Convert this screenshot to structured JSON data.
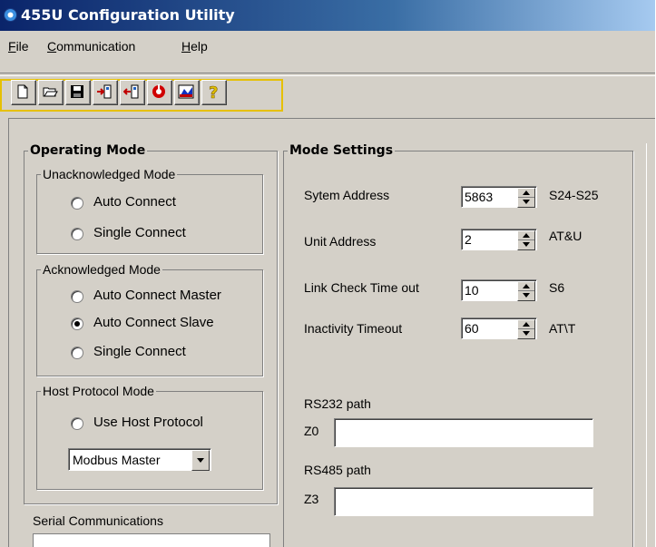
{
  "window": {
    "title": "455U Configuration Utility"
  },
  "menu": [
    {
      "label_pre": "",
      "accel": "F",
      "label_post": "ile"
    },
    {
      "label_pre": "",
      "accel": "C",
      "label_post": "ommunication"
    },
    {
      "label_pre": "",
      "accel": "H",
      "label_post": "elp"
    }
  ],
  "toolbar": {
    "buttons": [
      "new-file-icon",
      "open-folder-icon",
      "save-disk-icon",
      "read-config-icon",
      "write-config-icon",
      "reset-icon",
      "graph-icon",
      "help-icon"
    ]
  },
  "operating_mode": {
    "title": "Operating Mode",
    "unack": {
      "title": "Unacknowledged Mode",
      "options": [
        "Auto Connect",
        "Single Connect"
      ],
      "selected": -1
    },
    "ack": {
      "title": "Acknowledged Mode",
      "options": [
        "Auto Connect Master",
        "Auto Connect Slave",
        "Single Connect"
      ],
      "selected": 1
    },
    "host": {
      "title": "Host Protocol Mode",
      "option": "Use Host Protocol",
      "combo_value": "Modbus Master"
    }
  },
  "serial": {
    "title": "Serial Communications"
  },
  "mode_settings": {
    "title": "Mode Settings",
    "fields": [
      {
        "label": "Sytem Address",
        "value": "5863",
        "code": "S24-S25"
      },
      {
        "label": "Unit Address",
        "value": "2",
        "code": "AT&U"
      },
      {
        "label": "Link Check Time out",
        "value": "10",
        "code": "S6"
      },
      {
        "label": "Inactivity Timeout",
        "value": "60",
        "code": "AT\\T"
      }
    ],
    "rs232": {
      "label": "RS232 path",
      "prefix": "Z0",
      "value": ""
    },
    "rs485": {
      "label": "RS485 path",
      "prefix": "Z3",
      "value": ""
    }
  },
  "colors": {
    "face": "#d4d0c8",
    "title_start": "#0a246a",
    "title_end": "#a6caf0",
    "toolbar_highlight": "#e6c000"
  }
}
